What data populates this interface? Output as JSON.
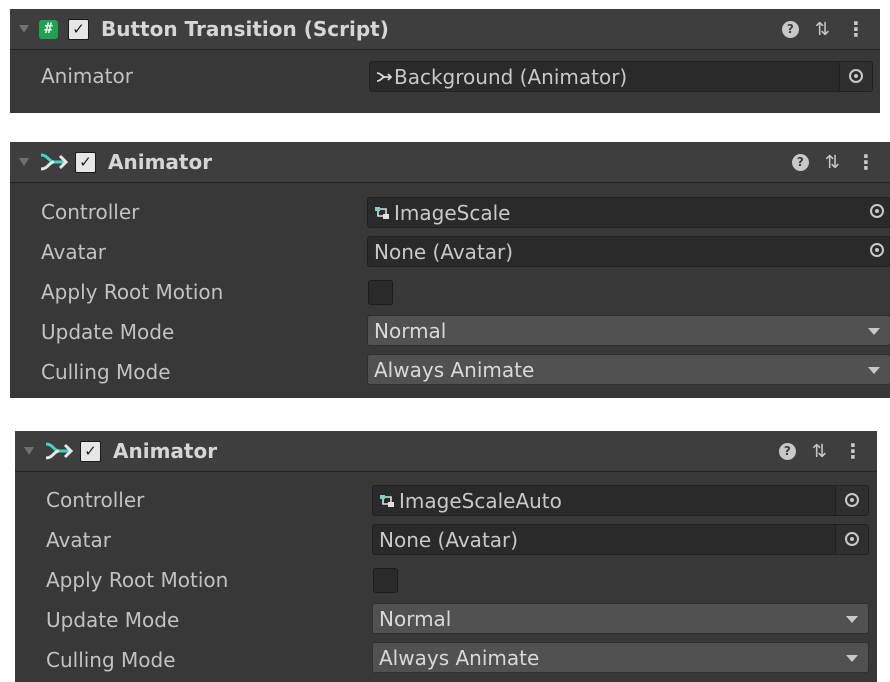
{
  "button_transition": {
    "title": "Button Transition (Script)",
    "script_icon": "#",
    "enabled": true,
    "fields": [
      {
        "label": "Animator",
        "value": "Background (Animator)"
      }
    ]
  },
  "animator_1": {
    "title": "Animator",
    "enabled": true,
    "controller_label": "Controller",
    "controller_value": "ImageScale",
    "avatar_label": "Avatar",
    "avatar_value": "None (Avatar)",
    "apply_root_motion_label": "Apply Root Motion",
    "apply_root_motion": false,
    "update_mode_label": "Update Mode",
    "update_mode_value": "Normal",
    "culling_mode_label": "Culling Mode",
    "culling_mode_value": "Always Animate"
  },
  "animator_2": {
    "title": "Animator",
    "enabled": true,
    "controller_label": "Controller",
    "controller_value": "ImageScaleAuto",
    "avatar_label": "Avatar",
    "avatar_value": "None (Avatar)",
    "apply_root_motion_label": "Apply Root Motion",
    "apply_root_motion": false,
    "update_mode_label": "Update Mode",
    "update_mode_value": "Normal",
    "culling_mode_label": "Culling Mode",
    "culling_mode_value": "Always Animate"
  },
  "header_icons": {
    "check_glyph": "✓",
    "help_glyph": "?",
    "preset_glyph": "⇅",
    "menu_glyph": "⋮"
  },
  "colors": {
    "panel_bg": "#383838",
    "header_bg": "#3e3e3e",
    "field_bg": "#2a2a2a",
    "dropdown_bg": "#515151",
    "script_icon_green": "#1fa353",
    "animator_icon_teal": "#42d5c3"
  }
}
